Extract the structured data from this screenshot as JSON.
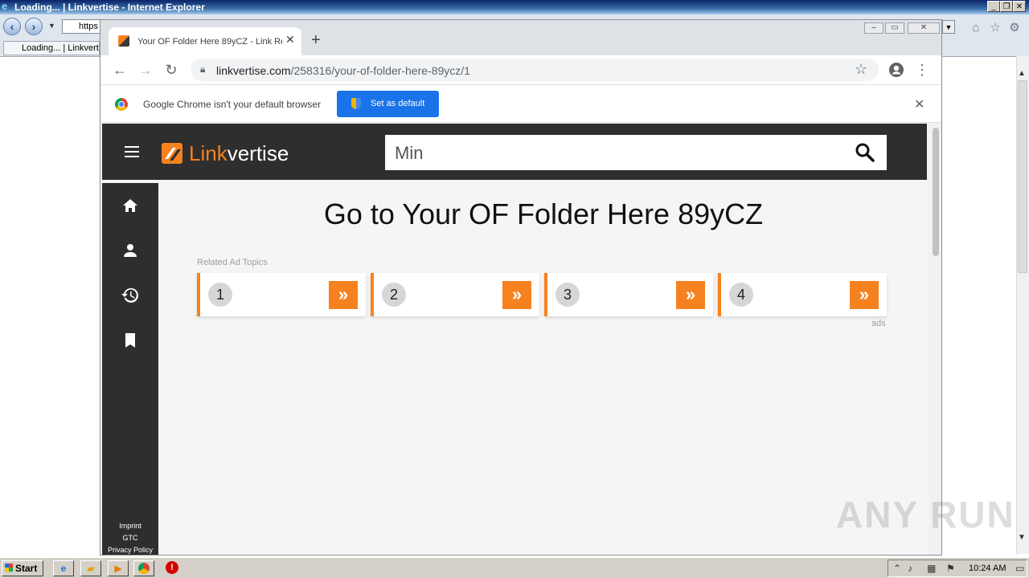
{
  "ie": {
    "title": "Loading... | Linkvertise - Internet Explorer",
    "address": "https",
    "tab_label": "Loading... | Linkvert"
  },
  "chrome": {
    "tab_title": "Your OF Folder Here 89yCZ - Link Re",
    "url_domain": "linkvertise.com",
    "url_path": "/258316/your-of-folder-here-89ycz/1",
    "infobar_text": "Google Chrome isn't your default browser",
    "set_default_label": "Set as default"
  },
  "page": {
    "logo_accent": "Link",
    "logo_rest": "vertise",
    "search_value": "Min",
    "title": "Go to Your OF Folder Here 89yCZ",
    "related_label": "Related Ad Topics",
    "ad_cards": [
      {
        "num": "1",
        "go": "»"
      },
      {
        "num": "2",
        "go": "»"
      },
      {
        "num": "3",
        "go": "»"
      },
      {
        "num": "4",
        "go": "»"
      }
    ],
    "ads_label": "ads",
    "sidebar_links": [
      "Imprint",
      "GTC",
      "Privacy Policy"
    ]
  },
  "watermark": "ANY RUN",
  "taskbar": {
    "start_label": "Start",
    "clock": "10:24 AM"
  },
  "colors": {
    "brand_orange": "#f6821f",
    "header_dark": "#2e2e2e",
    "chrome_blue": "#1a73e8"
  }
}
